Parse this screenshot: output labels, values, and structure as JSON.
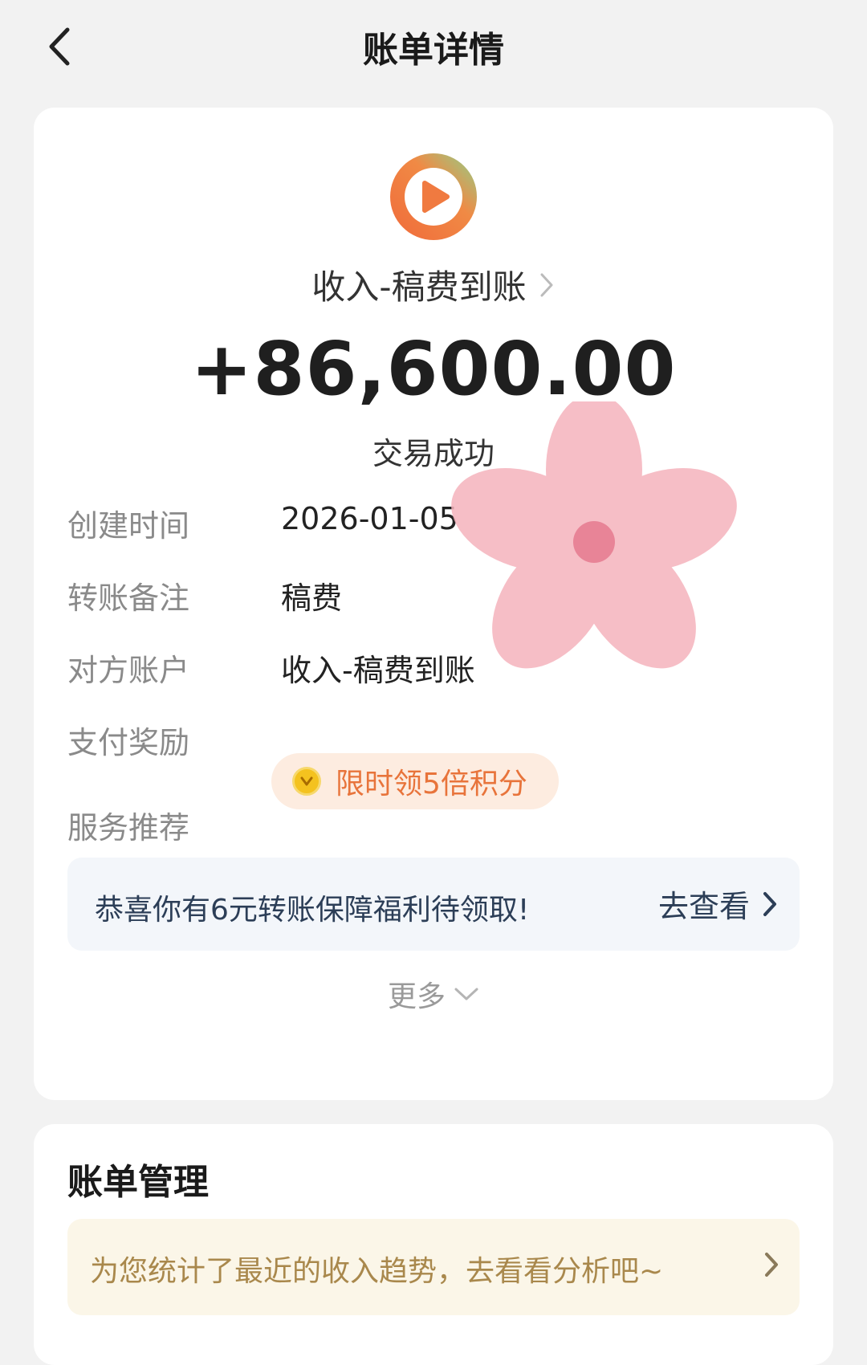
{
  "header": {
    "title": "账单详情"
  },
  "transaction": {
    "merchant": "收入-稿费到账",
    "amount": "+86,600.00",
    "status": "交易成功"
  },
  "details": [
    {
      "label": "创建时间",
      "value": "2026-01-05"
    },
    {
      "label": "转账备注",
      "value": "稿费"
    },
    {
      "label": "对方账户",
      "value": "收入-稿费到账"
    },
    {
      "label": "支付奖励",
      "value": ""
    },
    {
      "label": "服务推荐",
      "value": ""
    }
  ],
  "reward": {
    "text": "限时领5倍积分"
  },
  "promo": {
    "text": "恭喜你有6元转账保障福利待领取!",
    "link": "去查看"
  },
  "more": {
    "label": "更多"
  },
  "manage": {
    "title": "账单管理",
    "trend_text": "为您统计了最近的收入趋势，去看看分析吧~"
  },
  "colors": {
    "accent_orange": "#e8743b",
    "logo_gradient": [
      "#f06a3a",
      "#8fd18a"
    ],
    "sticker_pink": "#f4a9b4"
  },
  "icons": [
    "back-arrow-icon",
    "video-app-logo-icon",
    "chevron-right-icon",
    "coin-icon",
    "chevron-down-icon"
  ]
}
